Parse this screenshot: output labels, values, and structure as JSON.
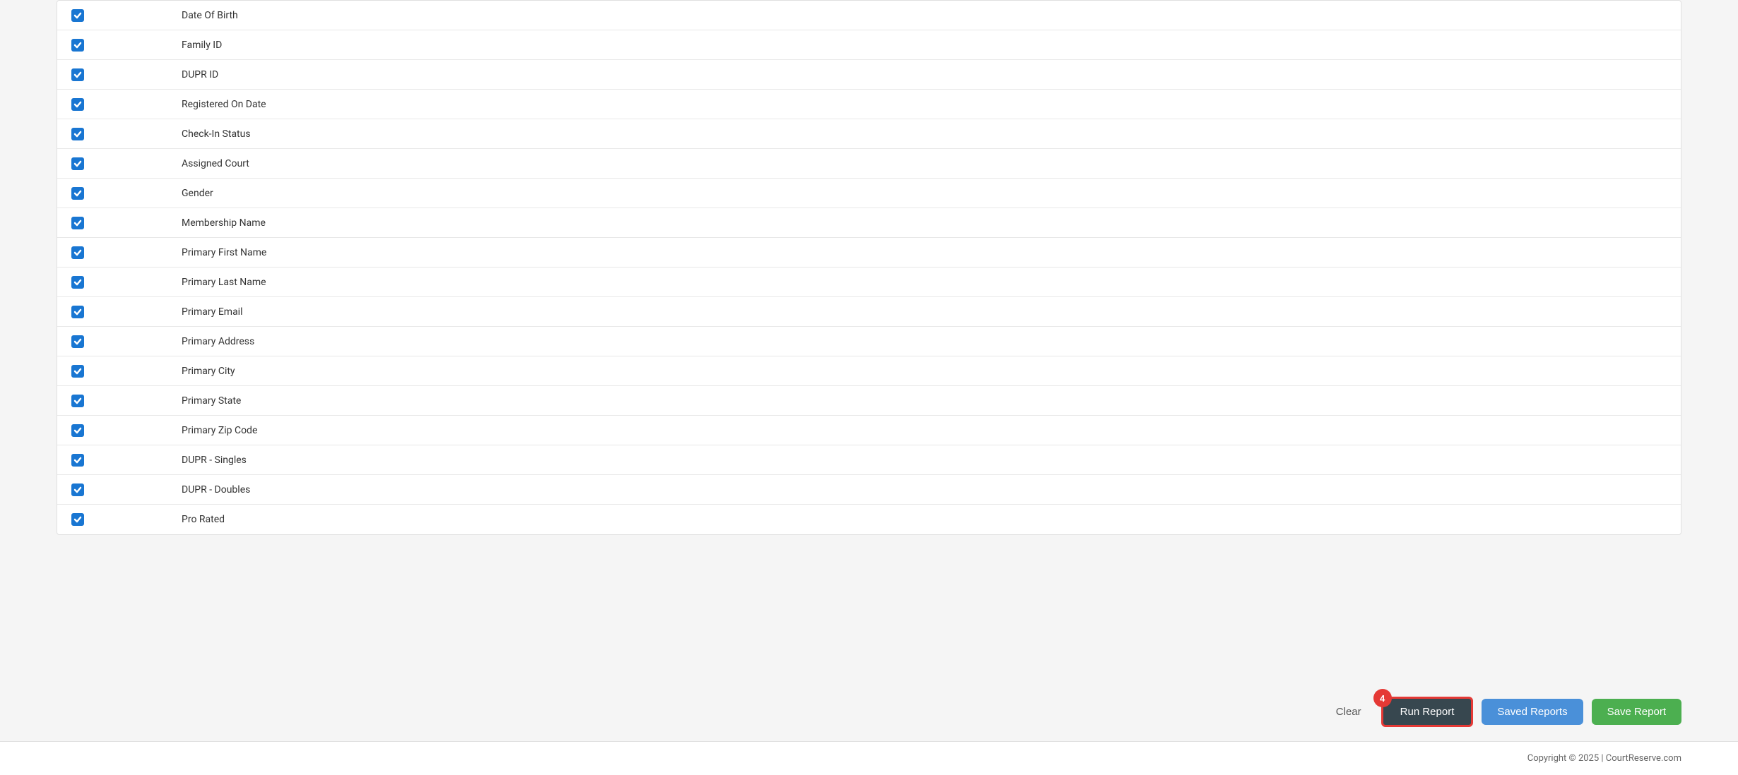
{
  "fields": [
    {
      "label": "Date Of Birth",
      "checked": true
    },
    {
      "label": "Family ID",
      "checked": true
    },
    {
      "label": "DUPR ID",
      "checked": true
    },
    {
      "label": "Registered On Date",
      "checked": true
    },
    {
      "label": "Check-In Status",
      "checked": true
    },
    {
      "label": "Assigned Court",
      "checked": true
    },
    {
      "label": "Gender",
      "checked": true
    },
    {
      "label": "Membership Name",
      "checked": true
    },
    {
      "label": "Primary First Name",
      "checked": true
    },
    {
      "label": "Primary Last Name",
      "checked": true
    },
    {
      "label": "Primary Email",
      "checked": true
    },
    {
      "label": "Primary Address",
      "checked": true
    },
    {
      "label": "Primary City",
      "checked": true
    },
    {
      "label": "Primary State",
      "checked": true
    },
    {
      "label": "Primary Zip Code",
      "checked": true
    },
    {
      "label": "DUPR - Singles",
      "checked": true
    },
    {
      "label": "DUPR - Doubles",
      "checked": true
    },
    {
      "label": "Pro Rated",
      "checked": true
    }
  ],
  "buttons": {
    "clear": "Clear",
    "run_report": "Run Report",
    "saved_reports": "Saved Reports",
    "save_report": "Save Report"
  },
  "badge": {
    "count": "4"
  },
  "footer": {
    "copyright": "Copyright © 2025 | CourtReserve.com"
  }
}
